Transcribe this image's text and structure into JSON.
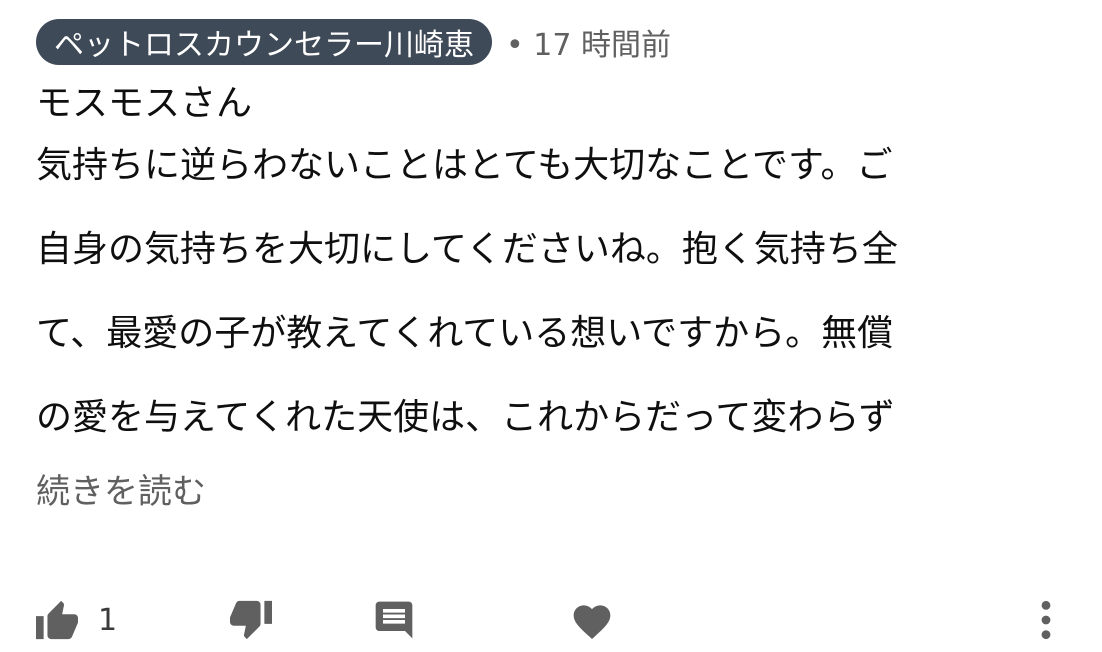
{
  "comment": {
    "author": "ペットロスカウンセラー川崎恵",
    "timestamp": "• 17 時間前",
    "salutation": "モスモスさん",
    "body_lines": [
      "気持ちに逆らわないことはとても大切なことです。ご",
      "自身の気持ちを大切にしてくださいね。抱く気持ち全",
      "て、最愛の子が教えてくれている想いですから。無償",
      "の愛を与えてくれた天使は、これからだって変わらず"
    ],
    "read_more_label": "続きを読む"
  },
  "actions": {
    "like_count": "1",
    "icons": {
      "like": "thumbs-up-icon",
      "dislike": "thumbs-down-icon",
      "reply": "comment-icon",
      "heart": "heart-icon",
      "more": "more-vertical-icon"
    }
  },
  "colors": {
    "author_chip_bg": "#3f4a58",
    "icon_gray": "#606060",
    "secondary_text": "#606060"
  }
}
